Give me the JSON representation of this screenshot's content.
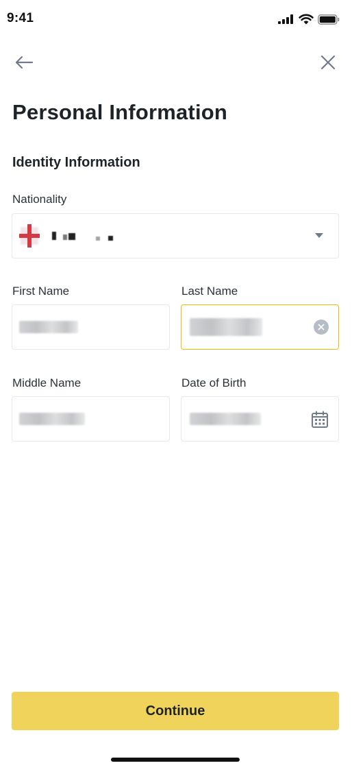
{
  "status_bar": {
    "time": "9:41",
    "icons": [
      "cellular-signal-icon",
      "wifi-icon",
      "battery-icon"
    ]
  },
  "nav": {
    "back_icon": "arrow-left-icon",
    "close_icon": "close-icon"
  },
  "page": {
    "title": "Personal Information",
    "section_title": "Identity Information"
  },
  "form": {
    "nationality": {
      "label": "Nationality",
      "value_redacted": true,
      "control_icon": "chevron-down-icon"
    },
    "first_name": {
      "label": "First Name",
      "value_redacted": true
    },
    "last_name": {
      "label": "Last Name",
      "value_redacted": true,
      "focused": true,
      "control_icon": "clear-icon"
    },
    "middle_name": {
      "label": "Middle Name",
      "value_redacted": true
    },
    "date_of_birth": {
      "label": "Date of Birth",
      "value_redacted": true,
      "control_icon": "calendar-icon"
    }
  },
  "actions": {
    "continue_label": "Continue"
  },
  "colors": {
    "accent": "#f0b90b",
    "button_bg": "#f0d35a",
    "text_primary": "#1e2329",
    "border": "#e6e8ea",
    "icon_gray": "#707a8a"
  }
}
